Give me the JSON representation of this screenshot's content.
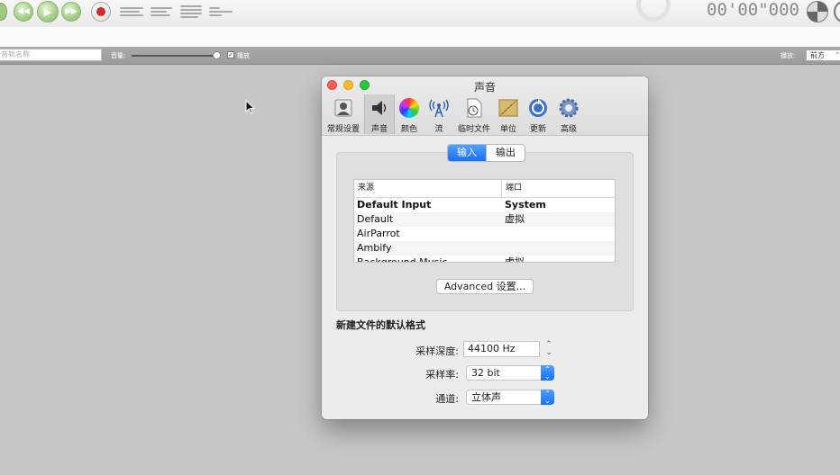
{
  "toolbar": {
    "time": "00'00\"000",
    "icons": [
      "rewind-icon",
      "play-icon",
      "fast-forward-icon",
      "record-icon",
      "waveform-icon",
      "trim-icon",
      "mixer-icon",
      "split-icon"
    ]
  },
  "control_bar": {
    "track_name_placeholder": "音轨名称",
    "volume_label": "音量:",
    "volume_level": 0.96,
    "play_checkbox_label": "播放",
    "play_checked": true,
    "playback_label": "播放:",
    "playback_value": "前方"
  },
  "prefs": {
    "title": "声音",
    "tabs": [
      {
        "label": "常规设置",
        "icon": "general-icon"
      },
      {
        "label": "声音",
        "icon": "speaker-icon",
        "active": true
      },
      {
        "label": "颜色",
        "icon": "color-wheel-icon"
      },
      {
        "label": "流",
        "icon": "broadcast-icon"
      },
      {
        "label": "临时文件",
        "icon": "temp-file-icon"
      },
      {
        "label": "单位",
        "icon": "ruler-icon"
      },
      {
        "label": "更新",
        "icon": "update-icon"
      },
      {
        "label": "高级",
        "icon": "gear-icon"
      }
    ],
    "segments": [
      "输入",
      "输出"
    ],
    "table": {
      "headers": [
        "来源",
        "端口"
      ],
      "rows": [
        [
          "Default Input",
          "System"
        ],
        [
          "Default",
          "虚拟"
        ],
        [
          "AirParrot",
          ""
        ],
        [
          "Ambify",
          ""
        ],
        [
          "Background Music",
          "虚拟"
        ]
      ]
    },
    "advanced_button": "Advanced 设置...",
    "section_title": "新建文件的默认格式",
    "sample_depth_label": "采样深度:",
    "sample_depth_value": "44100 Hz",
    "sample_rate_label": "采样率:",
    "sample_rate_value": "32 bit",
    "channels_label": "通道:",
    "channels_value": "立体声"
  },
  "colors": {
    "accent": "#1b6ff5",
    "toolbar_green": "#a7d18a",
    "record_red": "#d52a2a"
  }
}
